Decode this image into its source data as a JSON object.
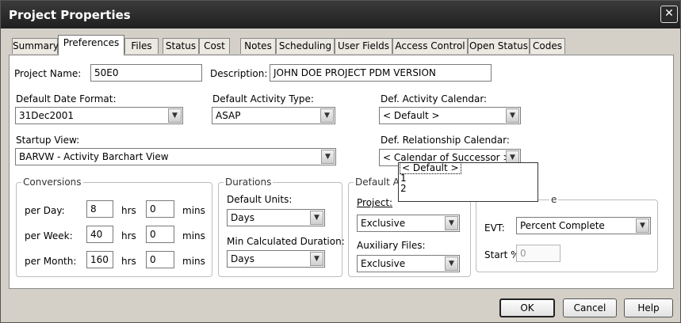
{
  "window": {
    "title": "Project Properties",
    "close_glyph": "✕"
  },
  "tabs": [
    {
      "label": "Summary"
    },
    {
      "label": "Preferences"
    },
    {
      "label": "Files"
    },
    {
      "label": "Status"
    },
    {
      "label": "Cost"
    },
    {
      "label": "Notes"
    },
    {
      "label": "Scheduling"
    },
    {
      "label": "User Fields"
    },
    {
      "label": "Access Control"
    },
    {
      "label": "Open Status"
    },
    {
      "label": "Codes"
    }
  ],
  "form": {
    "project_name_label": "Project Name:",
    "project_name_value": "50E0",
    "description_label": "Description:",
    "description_value": "JOHN DOE PROJECT PDM VERSION",
    "date_format_label": "Default Date Format:",
    "date_format_value": "31Dec2001",
    "activity_type_label": "Default Activity Type:",
    "activity_type_value": "ASAP",
    "activity_calendar_label": "Def. Activity Calendar:",
    "activity_calendar_value": "< Default >",
    "startup_view_label": "Startup View:",
    "startup_view_value": "BARVW - Activity Barchart View",
    "relationship_calendar_label": "Def. Relationship Calendar:",
    "relationship_calendar_value": "< Calendar of Successor >"
  },
  "relationship_dropdown": {
    "options": [
      "< Default >",
      "1",
      "2"
    ]
  },
  "conversions": {
    "title": "Conversions",
    "rows": [
      {
        "label": "per Day:",
        "hrs": "8",
        "mins": "0"
      },
      {
        "label": "per Week:",
        "hrs": "40",
        "mins": "0"
      },
      {
        "label": "per Month:",
        "hrs": "160",
        "mins": "0"
      }
    ],
    "hrs_unit": "hrs",
    "mins_unit": "mins"
  },
  "durations": {
    "title": "Durations",
    "default_units_label": "Default Units:",
    "default_units_value": "Days",
    "min_calc_label": "Min Calculated Duration:",
    "min_calc_value": "Days"
  },
  "default_access": {
    "title": "Default A",
    "project_label": "Project:",
    "project_value": "Exclusive",
    "aux_label": "Auxiliary Files:",
    "aux_value": "Exclusive"
  },
  "earned_value": {
    "title_partial": "e",
    "evt_label": "EVT:",
    "evt_value": "Percent Complete",
    "start_label": "Start %:",
    "start_value": "0"
  },
  "buttons": {
    "ok": "OK",
    "cancel": "Cancel",
    "help": "Help"
  }
}
